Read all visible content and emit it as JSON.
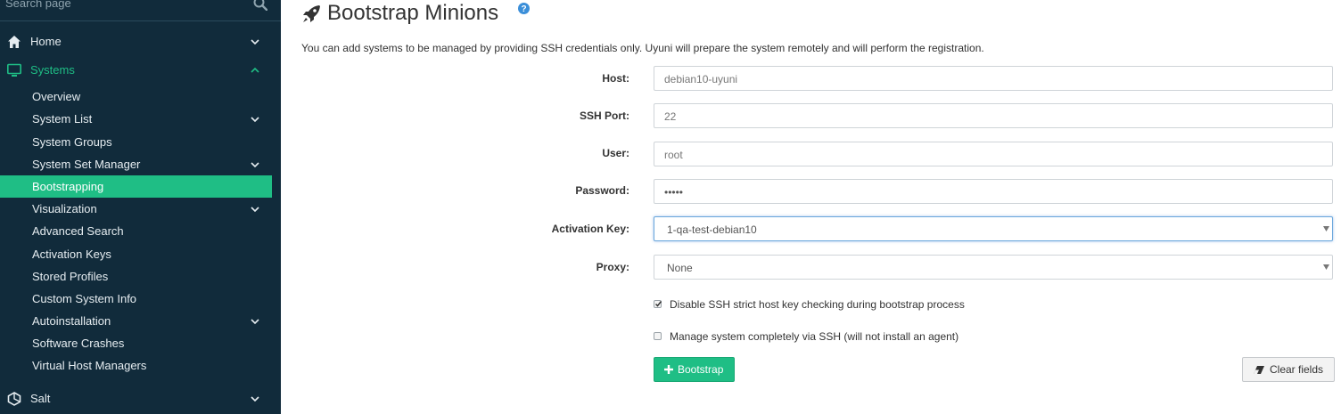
{
  "sidebar": {
    "search_placeholder": "Search page",
    "nav": {
      "home": "Home",
      "systems": "Systems",
      "salt": "Salt"
    },
    "systems_items": [
      "Overview",
      "System List",
      "System Groups",
      "System Set Manager",
      "Bootstrapping",
      "Visualization",
      "Advanced Search",
      "Activation Keys",
      "Stored Profiles",
      "Custom System Info",
      "Autoinstallation",
      "Software Crashes",
      "Virtual Host Managers"
    ],
    "active_item": "Bootstrapping"
  },
  "page": {
    "title": "Bootstrap Minions",
    "intro": "You can add systems to be managed by providing SSH credentials only. Uyuni will prepare the system remotely and will perform the registration."
  },
  "form": {
    "host": {
      "label": "Host:",
      "value": "debian10-uyuni"
    },
    "ssh_port": {
      "label": "SSH Port:",
      "value": "22"
    },
    "user": {
      "label": "User:",
      "value": "root"
    },
    "password": {
      "label": "Password:",
      "value": "•••••"
    },
    "activation_key": {
      "label": "Activation Key:",
      "value": "1-qa-test-debian10"
    },
    "proxy": {
      "label": "Proxy:",
      "value": "None"
    },
    "disable_strict_host_key": {
      "label": "Disable SSH strict host key checking during bootstrap process",
      "checked": true
    },
    "manage_via_ssh": {
      "label": "Manage system completely via SSH (will not install an agent)",
      "checked": false
    }
  },
  "buttons": {
    "bootstrap": "Bootstrap",
    "clear_fields": "Clear fields"
  },
  "colors": {
    "sidebar_bg": "#112b3b",
    "accent": "#1fbe85"
  }
}
